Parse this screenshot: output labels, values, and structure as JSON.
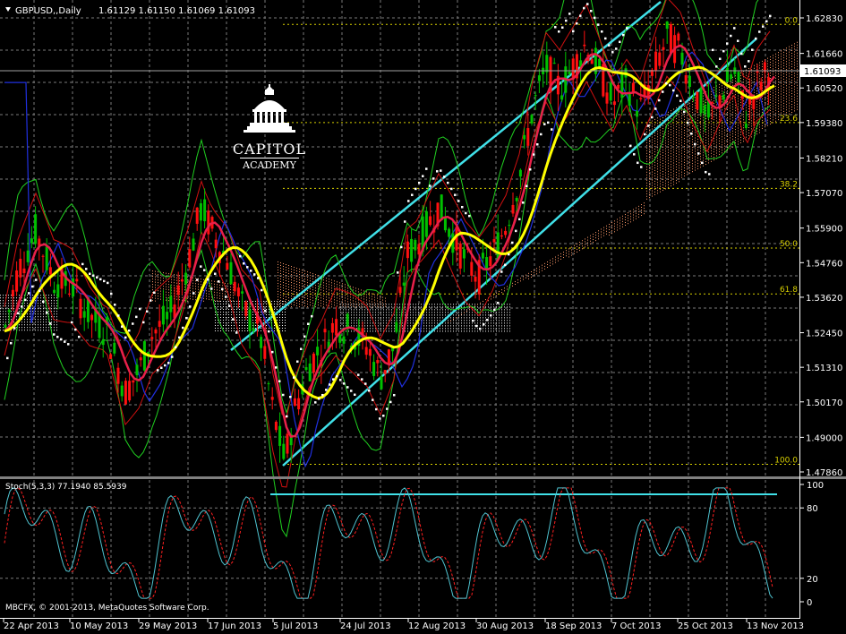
{
  "header": {
    "symbol_label": "GBPUSD,,Daily",
    "ohlc_values": "1.61129 1.61150 1.61069 1.61093"
  },
  "price_axis": {
    "labels": [
      "1.62830",
      "1.61660",
      "1.60520",
      "1.59380",
      "1.58210",
      "1.57070",
      "1.55900",
      "1.54760",
      "1.53620",
      "1.52450",
      "1.51310",
      "1.50170",
      "1.49000",
      "1.47860"
    ],
    "current_price": "1.61093"
  },
  "fib_levels": [
    {
      "label": "0.0",
      "price": 1.62615
    },
    {
      "label": "23.6",
      "price": 1.5938
    },
    {
      "label": "38.2",
      "price": 1.5721
    },
    {
      "label": "50.0",
      "price": 1.5524
    },
    {
      "label": "61.8",
      "price": 1.5373
    },
    {
      "label": "100.0",
      "price": 1.4811
    }
  ],
  "stoch": {
    "title": "Stoch(5,3,3) 77.1940 85.5939",
    "axis_labels": [
      "100",
      "80",
      "20",
      "0"
    ],
    "main_color": "#4fc3d0",
    "signal_color": "#ff2020"
  },
  "date_axis": {
    "labels": [
      "22 Apr 2013",
      "10 May 2013",
      "29 May 2013",
      "17 Jun 2013",
      "5 Jul 2013",
      "24 Jul 2013",
      "12 Aug 2013",
      "30 Aug 2013",
      "18 Sep 2013",
      "7 Oct 2013",
      "25 Oct 2013",
      "13 Nov 2013"
    ]
  },
  "logo": {
    "line1": "CAPITOL",
    "line2": "ACADEMY"
  },
  "copyright": "MBCFX, © 2001-2013, MetaQuotes Software Corp.",
  "colors": {
    "background": "#000000",
    "grid": "#7a7a7a",
    "bull_candle": "#00c000",
    "bear_candle": "#ff1010",
    "channel": "#40e0e8",
    "fib": "#d8d000",
    "ma_slow": "#ffff00",
    "ma_mid": "#e8204a",
    "psar": "#ffffff",
    "cloud": "#ff9a6a"
  }
}
